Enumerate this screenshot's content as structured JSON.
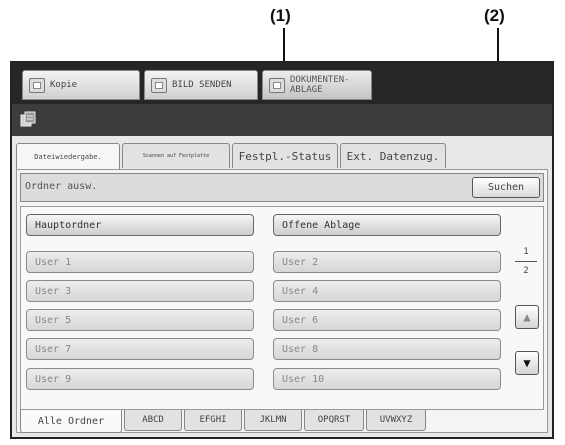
{
  "callouts": [
    "(1)",
    "(2)"
  ],
  "mode_tabs": [
    {
      "label": "Kopie",
      "icon": "copy-icon",
      "active": false
    },
    {
      "label": "BILD SENDEN",
      "icon": "image-send-icon",
      "active": false
    },
    {
      "label": "DOKUMENTEN-\nABLAGE",
      "icon": "document-filing-icon",
      "active": true
    }
  ],
  "title_icon": "document-filing-icon",
  "sub_tabs": [
    "Dateiwiedergabe.",
    "Scannen auf Festplatte",
    "Festpl.-Status",
    "Ext. Datenzug."
  ],
  "folder_bar": {
    "label": "Ordner ausw.",
    "search_label": "Suchen"
  },
  "folders": {
    "main": "Hauptordner",
    "public": "Offene Ablage",
    "users": [
      "User 1",
      "User 2",
      "User 3",
      "User 4",
      "User 5",
      "User 6",
      "User 7",
      "User 8",
      "User 9",
      "User 10"
    ]
  },
  "pagination": {
    "current": "1",
    "total": "2"
  },
  "scroll": {
    "up": "▲",
    "down": "▼"
  },
  "alpha_tabs": [
    "Alle Ordner",
    "ABCD",
    "EFGHI",
    "JKLMN",
    "OPQRST",
    "UVWXYZ"
  ]
}
